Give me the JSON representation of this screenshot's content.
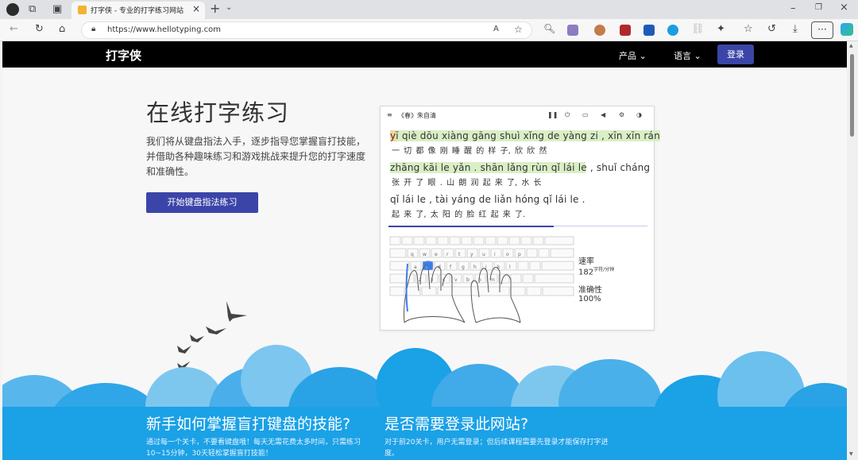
{
  "browser": {
    "tab_title": "打字侠 - 专业的打字练习网站",
    "url": "https://www.hellotyping.com"
  },
  "nav": {
    "brand": "打字侠",
    "products": "产品",
    "language": "语言",
    "login": "登录"
  },
  "hero": {
    "title": "在线打字练习",
    "description": "我们将从键盘指法入手，逐步指导您掌握盲打技能，并借助各种趣味练习和游戏挑战来提升您的打字速度和准确性。",
    "cta": "开始键盘指法练习"
  },
  "practice": {
    "title": "《春》朱自清",
    "lines": [
      {
        "pinyin": "yī qiè dōu xiàng gāng shuì xǐng de yàng zi , xīn xīn rán",
        "hanzi": "一 切 都 像 刚 睡 醒 的 样 子, 欣 欣 然"
      },
      {
        "pinyin": "zhāng kāi le yǎn . shān lǎng rùn qǐ lái le , shuǐ cháng",
        "hanzi": "张 开 了 眼 . 山 朗 润 起 来 了, 水 长"
      },
      {
        "pinyin": "qǐ lái le , tài yáng de liǎn hóng qǐ lái le .",
        "hanzi": "起 来 了, 太 阳 的 脸 红 起 来 了."
      }
    ],
    "speed_label": "速率",
    "speed_value": "182",
    "speed_unit": "字符/分钟",
    "accuracy_label": "准确性",
    "accuracy_value": "100%"
  },
  "sections": [
    {
      "title": "新手如何掌握盲打键盘的技能?",
      "desc": "通过每一个关卡，不要看键盘哦！每天无需花费太多时间，只需练习10~15分钟，30天轻松掌握盲打技能！"
    },
    {
      "title": "是否需要登录此网站?",
      "desc": "对于前20关卡，用户无需登录；但后续课程需要先登录才能保存打字进度。"
    }
  ],
  "colors": {
    "accent": "#3b45a8",
    "cloud_blue": "#1ba1e6",
    "nav_bg": "#000000"
  }
}
